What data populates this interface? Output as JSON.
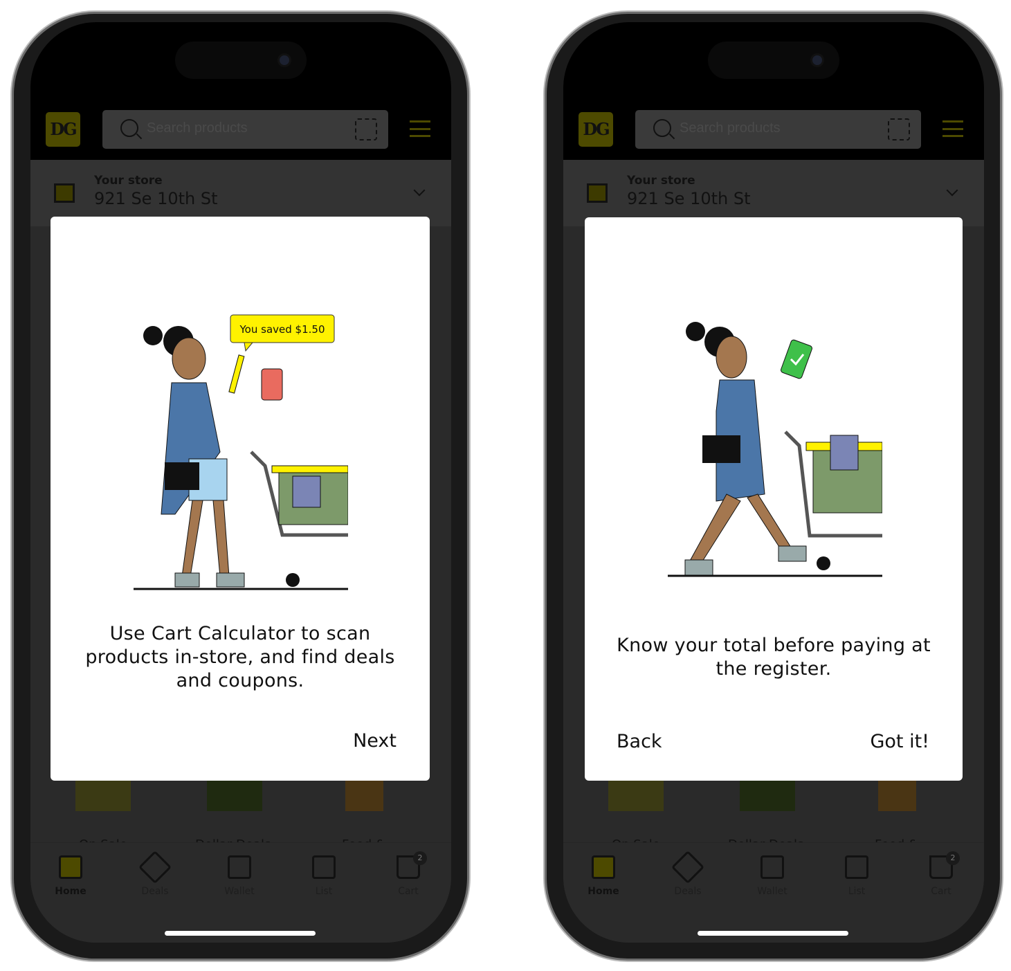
{
  "screens": [
    {
      "logo": "DG",
      "search_placeholder": "Search products",
      "store_label": "Your store",
      "store_address": "921 Se 10th St",
      "tiles": [
        "On Sale",
        "Dollar Deals",
        "Food &"
      ],
      "nav": [
        {
          "label": "Home",
          "icon": "home-icon",
          "active": true
        },
        {
          "label": "Deals",
          "icon": "tag-icon"
        },
        {
          "label": "Wallet",
          "icon": "wallet-icon"
        },
        {
          "label": "List",
          "icon": "checklist-icon"
        },
        {
          "label": "Cart",
          "icon": "cart-icon",
          "badge": "2"
        }
      ],
      "modal": {
        "bubble": "You saved $1.50",
        "message": "Use Cart Calculator to scan products in-store, and find deals and coupons.",
        "next": "Next"
      }
    },
    {
      "logo": "DG",
      "search_placeholder": "Search products",
      "store_label": "Your store",
      "store_address": "921 Se 10th St",
      "tiles": [
        "On Sale",
        "Dollar Deals",
        "Food &"
      ],
      "nav": [
        {
          "label": "Home",
          "icon": "home-icon",
          "active": true
        },
        {
          "label": "Deals",
          "icon": "tag-icon"
        },
        {
          "label": "Wallet",
          "icon": "wallet-icon"
        },
        {
          "label": "List",
          "icon": "checklist-icon"
        },
        {
          "label": "Cart",
          "icon": "cart-icon",
          "badge": "2"
        }
      ],
      "modal": {
        "message": "Know your total before paying at the register.",
        "back": "Back",
        "got_it": "Got it!"
      }
    }
  ],
  "colors": {
    "brand_yellow": "#fff200",
    "overlay_dim": "#2a2a2a"
  }
}
